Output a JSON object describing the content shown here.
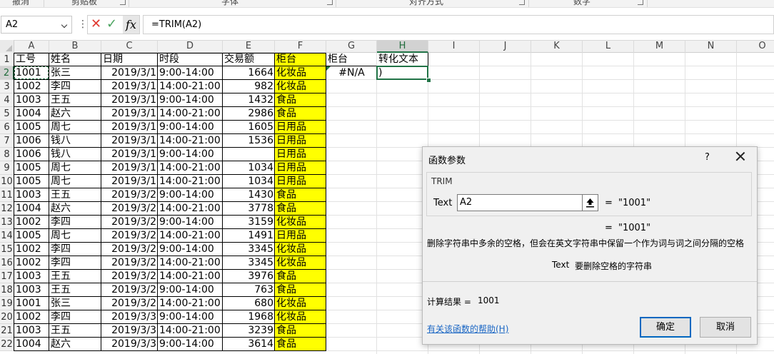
{
  "ribbon": {
    "groups": [
      "撤消",
      "剪贴板",
      "字体",
      "对齐方式",
      "数字"
    ]
  },
  "formula_bar": {
    "name_box": "A2",
    "menu_glyph": "⋮",
    "cancel_glyph": "✕",
    "enter_glyph": "✓",
    "fx_label": "fx",
    "formula": "=TRIM(A2)"
  },
  "grid": {
    "columns": [
      "A",
      "B",
      "C",
      "D",
      "E",
      "F",
      "G",
      "H",
      "I",
      "J",
      "K",
      "L",
      "M",
      "N",
      "O"
    ],
    "rows": [
      "1",
      "2",
      "3",
      "4",
      "5",
      "6",
      "7",
      "8",
      "9",
      "10",
      "11",
      "12",
      "13",
      "14",
      "15",
      "16",
      "17",
      "18",
      "19",
      "20",
      "21",
      "22"
    ],
    "headers": [
      "工号",
      "姓名",
      "日期",
      "时段",
      "交易额",
      "柜台",
      "柜台",
      "转化文本"
    ],
    "data": [
      [
        "1001",
        "张三",
        "2019/3/1",
        "9:00-14:00",
        "1664",
        "化妆品"
      ],
      [
        "1002",
        "李四",
        "2019/3/1",
        "14:00-21:00",
        "982",
        "化妆品"
      ],
      [
        "1003",
        "王五",
        "2019/3/1",
        "9:00-14:00",
        "1432",
        "食品"
      ],
      [
        "1004",
        "赵六",
        "2019/3/1",
        "14:00-21:00",
        "2986",
        "食品"
      ],
      [
        "1005",
        "周七",
        "2019/3/1",
        "9:00-14:00",
        "1605",
        "日用品"
      ],
      [
        "1006",
        "钱八",
        "2019/3/1",
        "14:00-21:00",
        "1536",
        "日用品"
      ],
      [
        "1006",
        "钱八",
        "2019/3/1",
        "9:00-14:00",
        "",
        "日用品"
      ],
      [
        "1005",
        "周七",
        "2019/3/1",
        "14:00-21:00",
        "1034",
        "日用品"
      ],
      [
        "1005",
        "周七",
        "2019/3/1",
        "14:00-21:00",
        "1034",
        "日用品"
      ],
      [
        "1003",
        "王五",
        "2019/3/2",
        "9:00-14:00",
        "1430",
        "食品"
      ],
      [
        "1004",
        "赵六",
        "2019/3/2",
        "14:00-21:00",
        "3778",
        "食品"
      ],
      [
        "1002",
        "李四",
        "2019/3/2",
        "9:00-14:00",
        "3159",
        "化妆品"
      ],
      [
        "1005",
        "周七",
        "2019/3/2",
        "14:00-21:00",
        "1491",
        "日用品"
      ],
      [
        "1002",
        "李四",
        "2019/3/2",
        "9:00-14:00",
        "3345",
        "化妆品"
      ],
      [
        "1002",
        "李四",
        "2019/3/2",
        "14:00-21:00",
        "3345",
        "化妆品"
      ],
      [
        "1003",
        "王五",
        "2019/3/2",
        "14:00-21:00",
        "3976",
        "食品"
      ],
      [
        "1003",
        "王五",
        "2019/3/2",
        "9:00-14:00",
        "763",
        "食品"
      ],
      [
        "1001",
        "张三",
        "2019/3/2",
        "14:00-21:00",
        "680",
        "化妆品"
      ],
      [
        "1002",
        "李四",
        "2019/3/3",
        "9:00-14:00",
        "1968",
        "化妆品"
      ],
      [
        "1003",
        "王五",
        "2019/3/3",
        "14:00-21:00",
        "3239",
        "食品"
      ],
      [
        "1004",
        "赵六",
        "2019/3/3",
        "9:00-14:00",
        "3614",
        "食品"
      ]
    ],
    "g2_value": "#N/A",
    "h2_value": ")"
  },
  "colors": {
    "highlight": "#ffff00",
    "accent": "#217346",
    "link": "#1a66c4",
    "primary_button_border": "#0067c0"
  },
  "dialog": {
    "title": "函数参数",
    "help_glyph": "?",
    "function_name": "TRIM",
    "arg_label": "Text",
    "arg_value": "A2",
    "equals": "=",
    "arg_result": "\"1001\"",
    "formula_result": "\"1001\"",
    "description": "删除字符串中多余的空格，但会在英文字符串中保留一个作为词与词之间分隔的空格",
    "arg_desc_name": "Text",
    "arg_desc_text": "要删除空格的字符串",
    "result_label": "计算结果 =",
    "result_value": "1001",
    "help_link": "有关该函数的帮助(H)",
    "ok_label": "确定",
    "cancel_label": "取消"
  }
}
